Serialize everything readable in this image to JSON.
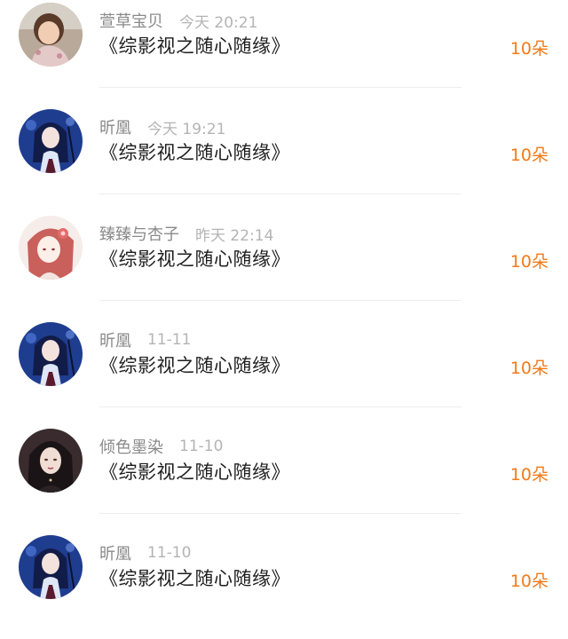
{
  "colors": {
    "name": "#8a8a8a",
    "time": "#b4b4b4",
    "title": "#1e1e1e",
    "gift": "#f07a1a",
    "divider": "#eeeeee"
  },
  "comments": [
    {
      "user": "萱草宝贝",
      "time": "今天 20:21",
      "title": "《综影视之随心随缘》",
      "gift": "10朵",
      "avatar": "child-photo-avatar"
    },
    {
      "user": "昕凰",
      "time": "今天 19:21",
      "title": "《综影视之随心随缘》",
      "gift": "10朵",
      "avatar": "anime-blue-hair-avatar"
    },
    {
      "user": "臻臻与杏子",
      "time": "昨天 22:14",
      "title": "《综影视之随心随缘》",
      "gift": "10朵",
      "avatar": "red-hair-girl-avatar"
    },
    {
      "user": "昕凰",
      "time": "11-11",
      "title": "《综影视之随心随缘》",
      "gift": "10朵",
      "avatar": "anime-blue-hair-avatar"
    },
    {
      "user": "倾色墨染",
      "time": "11-10",
      "title": "《综影视之随心随缘》",
      "gift": "10朵",
      "avatar": "dark-hair-woman-avatar"
    },
    {
      "user": "昕凰",
      "time": "11-10",
      "title": "《综影视之随心随缘》",
      "gift": "10朵",
      "avatar": "anime-blue-hair-avatar"
    }
  ]
}
